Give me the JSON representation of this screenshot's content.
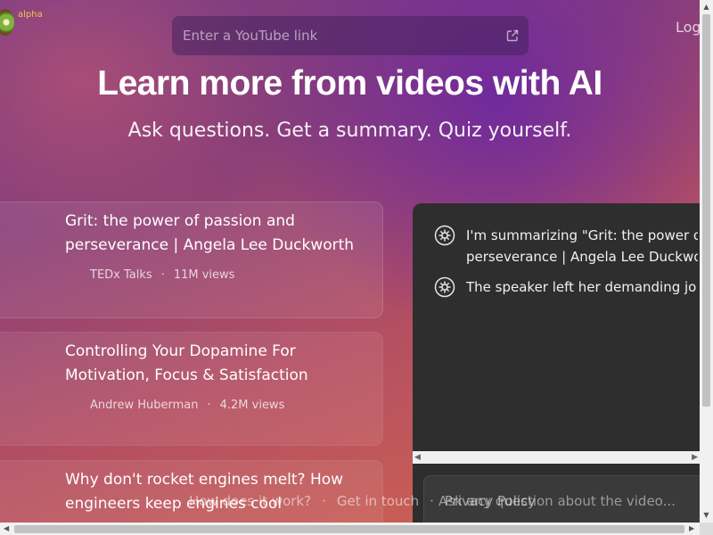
{
  "header": {
    "badge": "alpha",
    "login_label": "Log",
    "search_placeholder": "Enter a YouTube link"
  },
  "hero": {
    "title": "Learn more from videos with AI",
    "subtitle": "Ask questions. Get a summary. Quiz yourself."
  },
  "videos": [
    {
      "title_line1": "Grit: the power of passion and",
      "title_line2": "perseverance | Angela Lee Duckworth",
      "channel": "TEDx Talks",
      "views": "11M views"
    },
    {
      "title_line1": "Controlling Your Dopamine For",
      "title_line2": "Motivation, Focus & Satisfaction",
      "channel": "Andrew Huberman",
      "views": "4.2M views"
    },
    {
      "title_line1": "Why don't rocket engines melt? How",
      "title_line2": "engineers keep engines cool"
    }
  ],
  "chat": {
    "messages": [
      {
        "line1": "I'm summarizing \"Grit: the power o",
        "line2": "perseverance | Angela Lee Duckwo"
      },
      {
        "line1": "The speaker left her demanding jo"
      }
    ],
    "input_placeholder": "Ask any question about the video..."
  },
  "footer": {
    "how": "How does it work?",
    "contact": "Get in touch",
    "privacy": "Privacy Policy",
    "separator": "·"
  },
  "meta_separator": "·",
  "colors": {
    "brand_yellow": "#f4c34b",
    "chat_bg": "#2e2e2e"
  }
}
